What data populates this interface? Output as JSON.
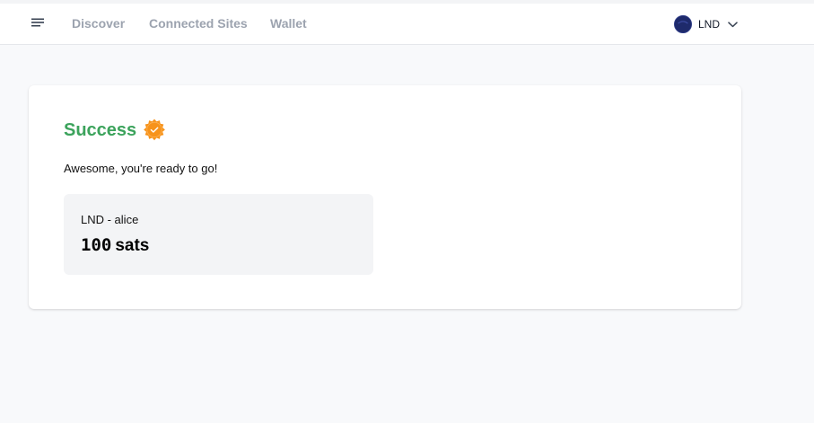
{
  "nav": {
    "menu_icon": "hamburger-menu-icon",
    "links": [
      "Discover",
      "Connected Sites",
      "Wallet"
    ],
    "account": {
      "label": "LND",
      "avatar_icon": "account-avatar-icon",
      "dropdown_icon": "chevron-down-icon",
      "avatar_color": "#1e2a6b"
    }
  },
  "card": {
    "title": "Success",
    "title_color": "#3ca35c",
    "badge_icon": "verified-badge-icon",
    "badge_color": "#f7931a",
    "message": "Awesome, you're ready to go!",
    "account_name": "LND - alice",
    "balance_amount": "100",
    "balance_unit": "sats"
  }
}
